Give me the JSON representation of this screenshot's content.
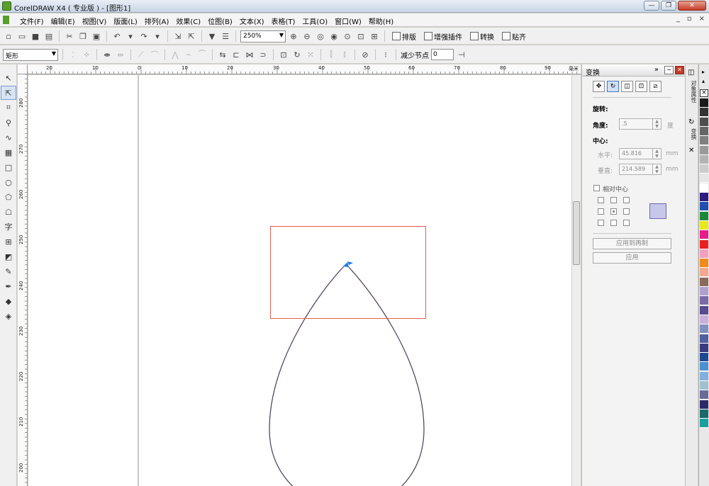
{
  "window": {
    "title": "CorelDRAW X4 ( 专业版 ) - [图形1]",
    "controls": [
      "—",
      "❐",
      "✕"
    ]
  },
  "menubar": {
    "items": [
      "文件(F)",
      "编辑(E)",
      "视图(V)",
      "版面(L)",
      "排列(A)",
      "效果(C)",
      "位图(B)",
      "文本(X)",
      "表格(T)",
      "工具(O)",
      "窗口(W)",
      "帮助(H)"
    ],
    "right_controls": [
      "_",
      "▫",
      "×"
    ]
  },
  "toolbar1": {
    "zoom": "250%",
    "buttons": [
      "排版",
      "增强插件",
      "转换",
      "贴齐"
    ]
  },
  "toolbar2": {
    "shape_type": "矩形",
    "reduce_nodes_label": "减少节点",
    "reduce_nodes_value": "0"
  },
  "ruler_h": [
    "20",
    "10",
    "0",
    "10",
    "20",
    "30",
    "40",
    "50",
    "60",
    "70",
    "80",
    "90",
    "毫米"
  ],
  "ruler_v": [
    "280",
    "270",
    "260",
    "250",
    "240",
    "230",
    "220",
    "210",
    "200"
  ],
  "docker": {
    "title": "变换",
    "rotate_label": "旋转:",
    "angle_label": "角度:",
    "angle_value": ".5",
    "angle_unit": "度",
    "center_label": "中心:",
    "h_label": "水平:",
    "h_value": "45.816",
    "h_unit": "mm",
    "v_label": "垂直:",
    "v_value": "214.589",
    "v_unit": "mm",
    "relative_center_label": "相对中心",
    "apply_copy_label": "应用到再制",
    "apply_label": "应用"
  },
  "side_tabs": [
    "对象属性",
    "变换"
  ],
  "palette": [
    "#1a1a1a",
    "#333333",
    "#4d4d4d",
    "#666666",
    "#808080",
    "#999999",
    "#b3b3b3",
    "#cccccc",
    "#e6e6e6",
    "#ffffff",
    "#2e1a7a",
    "#1f4fb0",
    "#1a8a3a",
    "#e8e81a",
    "#e81a8a",
    "#e82020",
    "#f2a0c0",
    "#f28a1a",
    "#f2a890",
    "#8a6a5a",
    "#b0a0d0",
    "#7a6aa8",
    "#5a4a90",
    "#c8b0d8",
    "#8090c0",
    "#5060a0",
    "#3a3a80",
    "#204a90",
    "#4a90d0",
    "#80b0e0",
    "#a0c0d0",
    "#6a6a9a",
    "#2a2a6a",
    "#1a6a6a",
    "#1aa0a0"
  ]
}
